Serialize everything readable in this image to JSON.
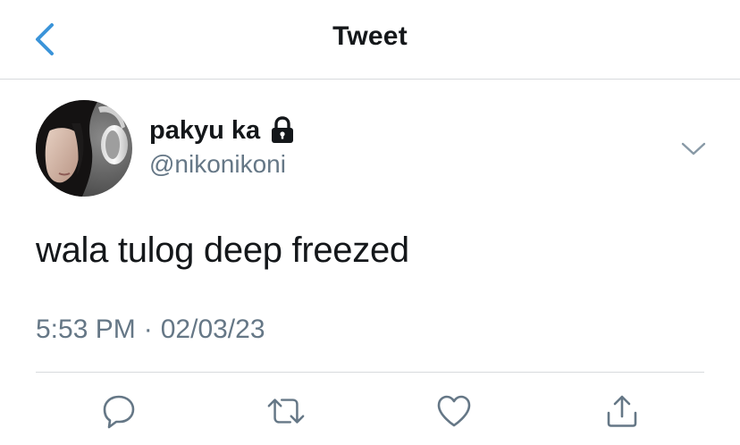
{
  "nav": {
    "title": "Tweet",
    "back_icon": "chevron-left-icon",
    "accent_color": "#3b94d9"
  },
  "tweet": {
    "author": {
      "display_name": "pakyu ka",
      "handle": "@nikonikoni",
      "protected_icon": "lock-icon",
      "avatar": "profile-photo"
    },
    "text": "wala tulog deep freezed",
    "time": "5:53 PM",
    "separator": "·",
    "date": "02/03/23",
    "more_icon": "chevron-down-icon"
  },
  "actions": [
    {
      "name": "reply",
      "icon": "reply-icon"
    },
    {
      "name": "retweet",
      "icon": "retweet-icon"
    },
    {
      "name": "like",
      "icon": "heart-icon"
    },
    {
      "name": "share",
      "icon": "share-icon"
    }
  ],
  "colors": {
    "text_primary": "#14171a",
    "text_secondary": "#657786",
    "divider": "#d7dadd",
    "icon_gray": "#657786"
  }
}
